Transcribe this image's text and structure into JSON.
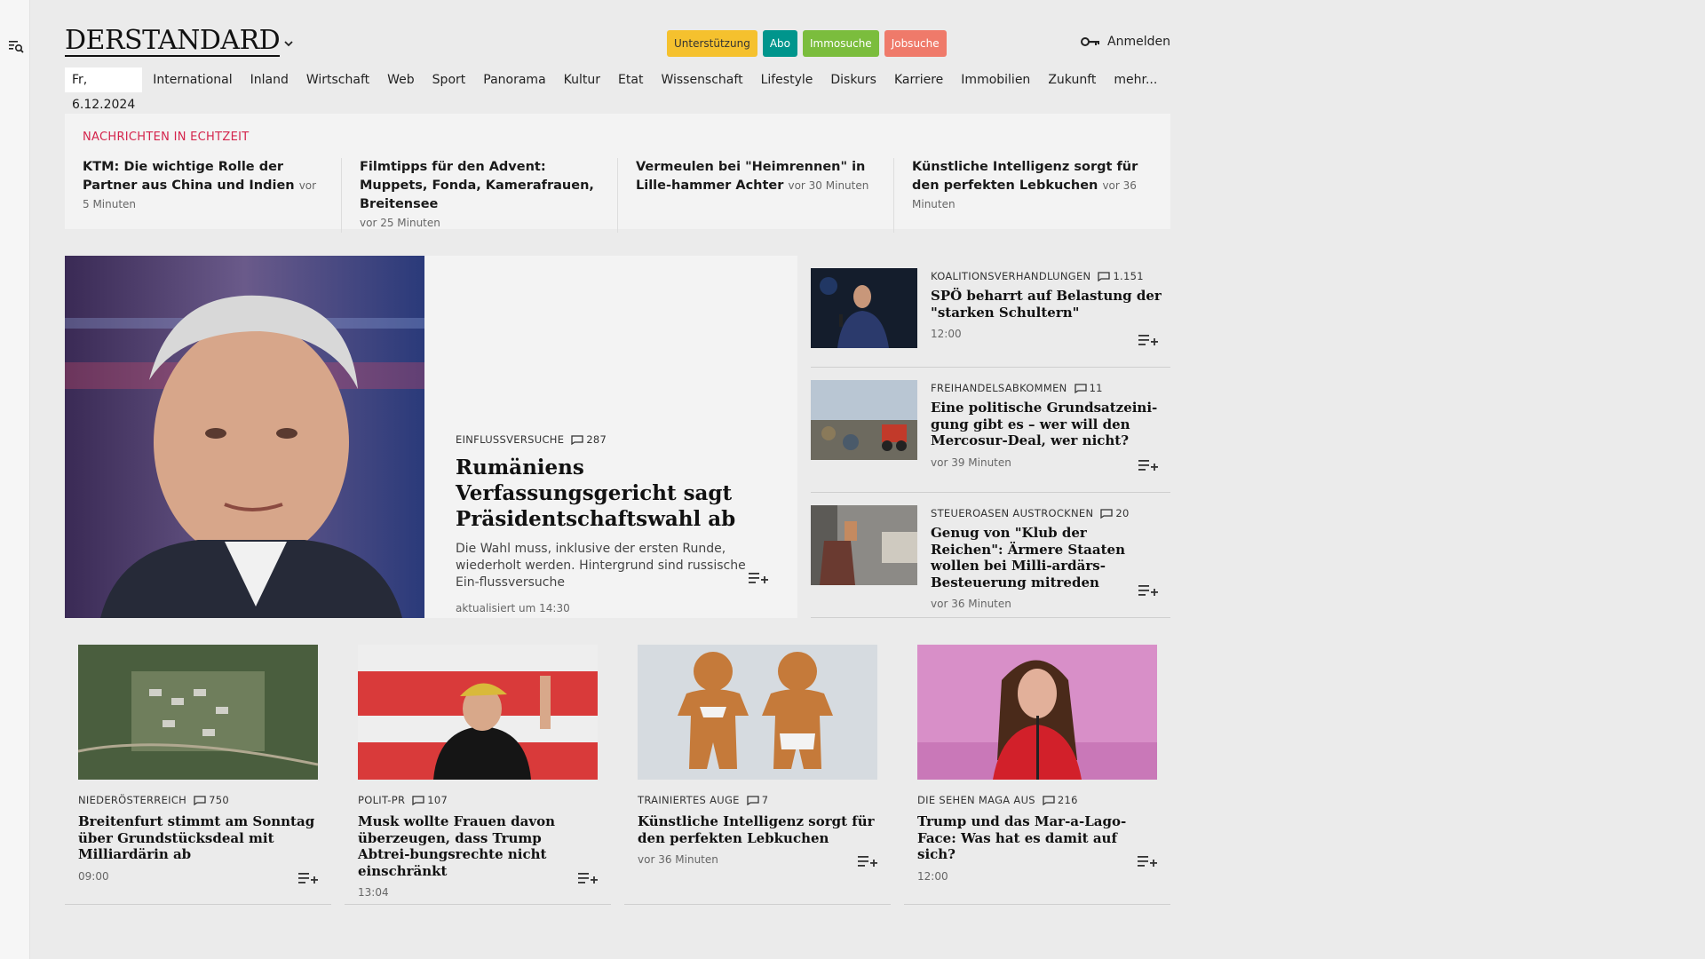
{
  "header": {
    "logo": "DERSTANDARD",
    "pills": [
      "Unterstützung",
      "Abo",
      "Immosuche",
      "Jobsuche"
    ],
    "login": "Anmelden"
  },
  "nav": {
    "date": "Fr, 6.12.2024",
    "items": [
      "International",
      "Inland",
      "Wirtschaft",
      "Web",
      "Sport",
      "Panorama",
      "Kultur",
      "Etat",
      "Wissenschaft",
      "Lifestyle",
      "Diskurs",
      "Karriere",
      "Immobilien",
      "Zukunft",
      "mehr..."
    ]
  },
  "ticker": {
    "title": "NACHRICHTEN IN ECHTZEIT",
    "items": [
      {
        "title": "KTM: Die wichtige Rolle der Partner aus China und Indien",
        "time": "vor 5 Minuten"
      },
      {
        "title": "Filmtipps für den Advent: Muppets, Fonda, Kamerafrauen, Breitensee",
        "time": "vor 25 Minuten"
      },
      {
        "title": "Vermeulen bei \"Heimrennen\" in Lille-hammer Achter",
        "time": "vor 30 Minuten"
      },
      {
        "title": "Künstliche Intelligenz sorgt für den perfekten Lebkuchen",
        "time": "vor 36 Minuten"
      }
    ]
  },
  "lead": {
    "kicker": "EINFLUSSVERSUCHE",
    "comments": "287",
    "title": "Rumäniens Verfassungsgericht sagt Präsidentschaftswahl ab",
    "teaser": "Die Wahl muss, inklusive der ersten Runde, wiederholt werden. Hintergrund sind russische Ein-flussversuche",
    "time": "aktualisiert um 14:30"
  },
  "side": [
    {
      "kicker": "KOALITIONSVERHANDLUNGEN",
      "comments": "1.151",
      "title": "SPÖ beharrt auf Belastung der \"starken Schultern\"",
      "time": "12:00"
    },
    {
      "kicker": "FREIHANDELSABKOMMEN",
      "comments": "11",
      "title": "Eine politische Grundsatzeini-gung gibt es – wer will den Mercosur-Deal, wer nicht?",
      "time": "vor 39 Minuten"
    },
    {
      "kicker": "STEUEROASEN AUSTROCKNEN",
      "comments": "20",
      "title": "Genug von \"Klub der Reichen\": Ärmere Staaten wollen bei Milli-ardärs-Besteuerung mitreden",
      "time": "vor 36 Minuten"
    }
  ],
  "cards": [
    {
      "kicker": "NIEDERÖSTERREICH",
      "comments": "750",
      "title": "Breitenfurt stimmt am Sonntag über Grundstücksdeal mit Milliardärin ab",
      "time": "09:00"
    },
    {
      "kicker": "POLIT-PR",
      "comments": "107",
      "title": "Musk wollte Frauen davon überzeugen, dass Trump Abtrei-bungsrechte nicht einschränkt",
      "time": "13:04"
    },
    {
      "kicker": "TRAINIERTES AUGE",
      "comments": "7",
      "title": "Künstliche Intelligenz sorgt für den perfekten Lebkuchen",
      "time": "vor 36 Minuten"
    },
    {
      "kicker": "DIE SEHEN MAGA AUS",
      "comments": "216",
      "title": "Trump und das Mar-a-Lago-Face: Was hat es damit auf sich?",
      "time": "12:00"
    }
  ],
  "icons": {
    "menu": "menu-search-icon",
    "chevron": "chevron-down-icon",
    "key": "key-icon",
    "comment": "comment-icon",
    "playlist": "playlist-add-icon"
  },
  "colors": {
    "ticker_title": "#d4244c",
    "support": "#f5c12e",
    "abo": "#00958c",
    "immo": "#7bbd3d",
    "jobs": "#ef7a6a"
  }
}
